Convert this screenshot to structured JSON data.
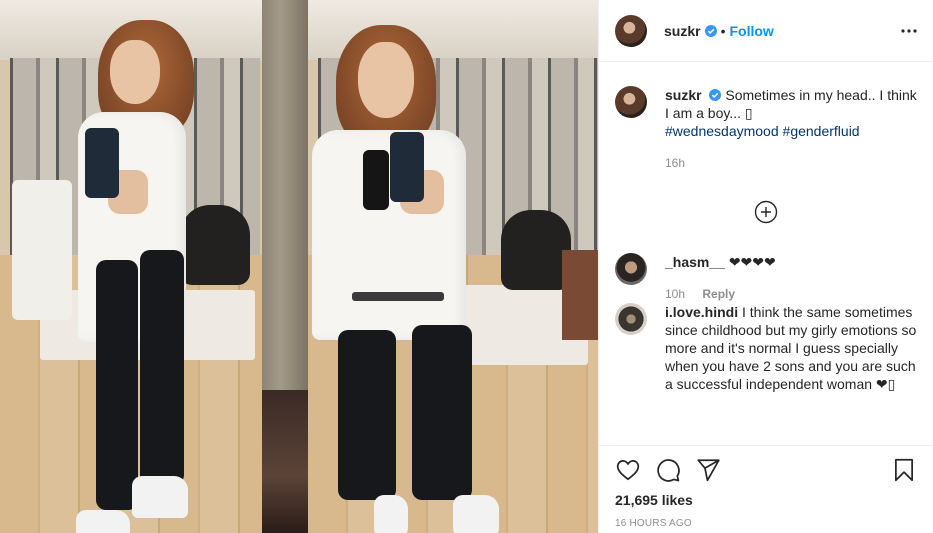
{
  "colors": {
    "accent": "#0095f6",
    "hashtag": "#00376b",
    "muted": "#8e8e8e",
    "text": "#262626"
  },
  "header": {
    "username": "suzkr",
    "separator": "•",
    "follow_label": "Follow",
    "more_icon": "more-horizontal-icon",
    "verified_icon": "verified-badge-icon"
  },
  "caption": {
    "username": "suzkr",
    "text": "Sometimes in my head.. I think I am a boy... ",
    "emoji": "▯",
    "hashtags": [
      "#wednesdaymood",
      "#genderfluid"
    ],
    "time": "16h"
  },
  "load_more_icon": "plus-circle-icon",
  "comments": [
    {
      "username": "_hasm__",
      "text": "❤❤❤❤",
      "time": "10h",
      "reply_label": "Reply"
    },
    {
      "username": "i.love.hindi",
      "text": "I think the same sometimes since childhood but my girly emotions so more and it's normal I guess specially when you have 2 sons and you are such a successful independent woman ❤▯"
    }
  ],
  "actions": {
    "icons": [
      "heart-icon",
      "comment-icon",
      "share-icon",
      "bookmark-icon"
    ],
    "likes": "21,695 likes",
    "time_ago": "16 HOURS AGO"
  }
}
